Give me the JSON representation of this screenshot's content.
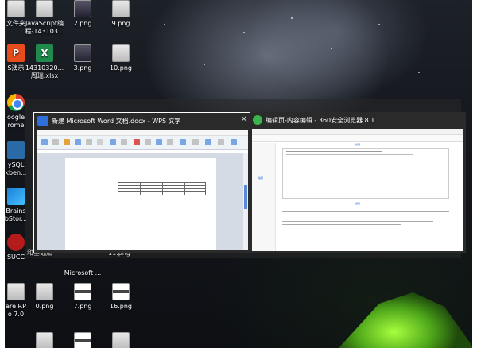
{
  "desktop": {
    "icons": [
      {
        "id": "wenjianjia",
        "label": "文件夹",
        "type": "png"
      },
      {
        "id": "js",
        "label": "JavaScript编\n程-143103...",
        "type": "png"
      },
      {
        "id": "png2",
        "label": "2.png",
        "type": "pngdark"
      },
      {
        "id": "png9",
        "label": "9.png",
        "type": "png"
      },
      {
        "id": "ps",
        "label": "S演示",
        "type": "ppt"
      },
      {
        "id": "xlsx",
        "label": "14310320...\n周瑞.xlsx",
        "type": "xls"
      },
      {
        "id": "png3",
        "label": "3.png",
        "type": "pngdark"
      },
      {
        "id": "png10",
        "label": "10.png",
        "type": "png"
      },
      {
        "id": "chrome",
        "label": "oogle\nrome",
        "type": "chrome"
      },
      {
        "id": "mysql",
        "label": "ySQL\nkben...",
        "type": "mysql"
      },
      {
        "id": "brains",
        "label": "Brains\nbStor...",
        "type": "brains"
      },
      {
        "id": "succ",
        "label": "SUCC",
        "type": "succ"
      },
      {
        "id": "word",
        "label": "Microsoft ...",
        "type": "word"
      },
      {
        "id": "rp",
        "label": "are RP\no 7.0",
        "type": "png"
      },
      {
        "id": "png0",
        "label": "0.png",
        "type": "png"
      },
      {
        "id": "png7",
        "label": "7.png",
        "type": "pngstrip"
      },
      {
        "id": "png16",
        "label": "16.png",
        "type": "pngstrip"
      }
    ],
    "dim_labels": {
      "left": "和基础加",
      "mid": "11.png"
    }
  },
  "task_switcher": {
    "windows": [
      {
        "id": "wps",
        "title": "新建 Microsoft Word 文档.docx - WPS 文字",
        "app_icon": "wps-writer-icon",
        "accent": "#2e6fd9",
        "selected": true
      },
      {
        "id": "360",
        "title": "编辑页-内容编辑 - 360安全浏览器 8.1",
        "app_icon": "360-browser-icon",
        "accent": "#3bb54a",
        "selected": false
      }
    ]
  },
  "thumb_360": {
    "link1": "编辑",
    "link2": "编辑",
    "link3": "编辑"
  }
}
